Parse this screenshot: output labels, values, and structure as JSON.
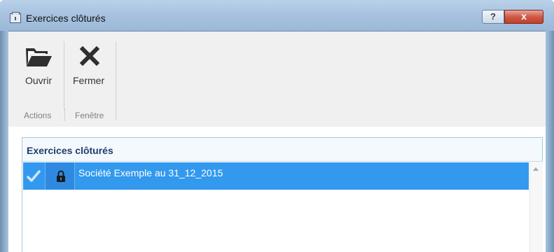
{
  "window": {
    "title": "Exercices clôturés",
    "help_label": "?",
    "close_label": "x"
  },
  "ribbon": {
    "buttons": [
      {
        "label": "Ouvrir",
        "icon": "folder-open-icon"
      },
      {
        "label": "Fermer",
        "icon": "close-x-icon"
      }
    ],
    "groups": [
      {
        "label": "Actions"
      },
      {
        "label": "Fenêtre"
      }
    ]
  },
  "grid": {
    "header": "Exercices clôturés",
    "rows": [
      {
        "checked": true,
        "locked": true,
        "label": "Société Exemple au 31_12_2015"
      }
    ]
  },
  "colors": {
    "selection": "#3399ee",
    "header_text": "#1f3d6b",
    "close_button": "#c2402b"
  }
}
